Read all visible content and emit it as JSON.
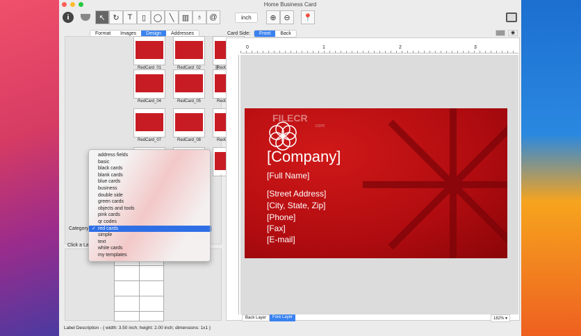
{
  "window": {
    "title": "Home Business Card"
  },
  "toolbar": {
    "tools": [
      "pointer",
      "rotate",
      "text",
      "rectangle",
      "ellipse",
      "line",
      "barcode",
      "fill",
      "at"
    ],
    "unit": "inch"
  },
  "left_tabs": [
    "Format",
    "Images",
    "Design",
    "Addresses"
  ],
  "left_active_tab": "Design",
  "thumbnails": [
    "RedCard_01",
    "RedCard_02",
    "RedCard_03",
    "RedCard_04",
    "RedCard_05",
    "RedCard_06",
    "RedCard_07",
    "RedCard_08",
    "RedCard_09"
  ],
  "category": {
    "label": "Category",
    "selected": "red cards",
    "options": [
      "address fields",
      "basic",
      "black cards",
      "blank cards",
      "blue cards",
      "business",
      "double side",
      "green cards",
      "objects and tools",
      "pink cards",
      "qr codes",
      "red cards",
      "simple",
      "text",
      "white cards",
      "my templates"
    ]
  },
  "click_hint": "Click a La",
  "card_side": {
    "label": "Card Side:",
    "options": [
      "Front",
      "Back"
    ],
    "selected": "Front"
  },
  "ruler": [
    "0",
    "1",
    "2",
    "3"
  ],
  "card": {
    "watermark": "FILECR",
    "watermark_sub": ".com",
    "company": "[Company]",
    "lines": [
      "[Full Name]",
      "[Street Address]",
      "[City, State, Zip]",
      "[Phone]",
      "[Fax]",
      "[E-mail]"
    ]
  },
  "layers": {
    "back": "Back Layer",
    "fore": "Fore Layer",
    "active": "Fore Layer"
  },
  "zoom": "182%",
  "status": "Label Description - { width: 3.50 inch; height: 2.00 inch; dimensions: 1x1 }"
}
